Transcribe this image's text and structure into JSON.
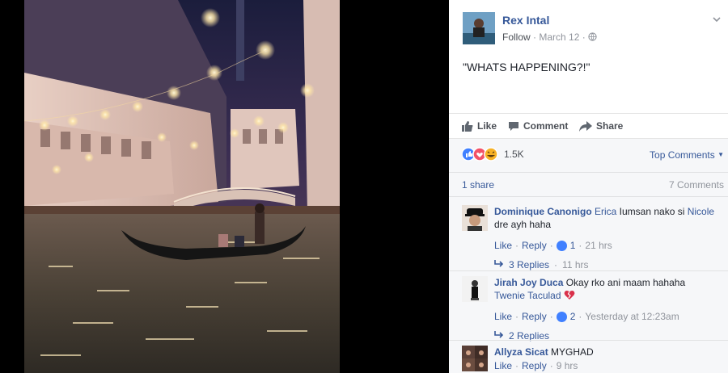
{
  "post": {
    "author": "Rex Intal",
    "follow_label": "Follow",
    "date": "March 12",
    "privacy_icon": "globe-icon",
    "text": "\"WHATS HAPPENING?!\""
  },
  "actions": {
    "like": "Like",
    "comment": "Comment",
    "share": "Share"
  },
  "summary": {
    "reaction_count": "1.5K",
    "top_comments": "Top Comments",
    "shares": "1 share",
    "comments_count": "7 Comments"
  },
  "comments": [
    {
      "name": "Dominique Canonigo",
      "tag1": "Erica",
      "mid": " Iumsan nako si ",
      "tag2": "Nicole",
      "tail": "dre ayh haha",
      "like": "Like",
      "reply": "Reply",
      "likes": "1",
      "time": "21 hrs",
      "replies": "3 Replies",
      "replies_time": "11 hrs"
    },
    {
      "name": "Jirah Joy Duca",
      "text": " Okay rko ani maam hahaha",
      "tag": "Twenie Taculad",
      "like": "Like",
      "reply": "Reply",
      "likes": "2",
      "time": "Yesterday at 12:23am",
      "replies": "2 Replies"
    },
    {
      "name": "Allyza Sicat",
      "text": " MYGHAD",
      "like": "Like",
      "reply": "Reply",
      "time": "9 hrs"
    }
  ],
  "colors": {
    "link": "#365899",
    "muted": "#90949c",
    "like_blue": "#4080ff",
    "love_red": "#f25268",
    "haha_yellow": "#f7b125"
  }
}
